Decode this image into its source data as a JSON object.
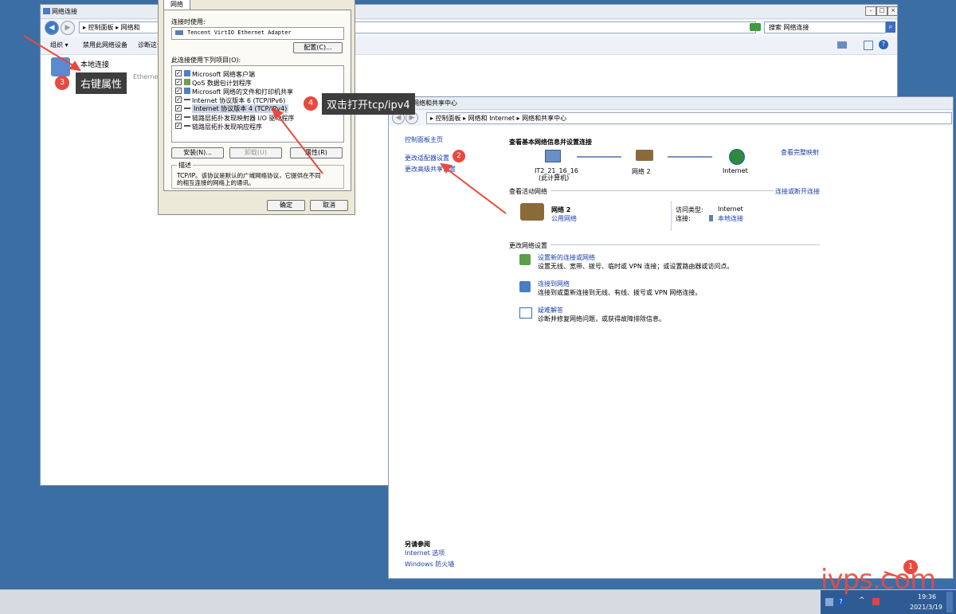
{
  "left_window": {
    "title": "网络连接",
    "address": "▸ 控制面板 ▸ 网络和",
    "search_placeholder": "搜索 网络连接",
    "toolbar": [
      "组织 ▾",
      "禁用此网络设备",
      "诊断这个"
    ],
    "item_name": "本地连接",
    "item_sub": "Ethernet A"
  },
  "dialog": {
    "tab": "网络",
    "connect_using_label": "连接时使用:",
    "adapter": "Tencent VirtIO Ethernet Adapter",
    "configure_button": "配置(C)...",
    "items_label": "此连接使用下列项目(O):",
    "items": [
      {
        "text": "Microsoft 网络客户端",
        "checked": true
      },
      {
        "text": "QoS 数据包计划程序",
        "checked": true
      },
      {
        "text": "Microsoft 网络的文件和打印机共享",
        "checked": true
      },
      {
        "text": "Internet 协议版本 6 (TCP/IPv6)",
        "checked": true
      },
      {
        "text": "Internet 协议版本 4 (TCP/IPv4)",
        "checked": true,
        "selected": true
      },
      {
        "text": "链路层拓扑发现映射器 I/O 驱动程序",
        "checked": true
      },
      {
        "text": "链路层拓扑发现响应程序",
        "checked": true
      }
    ],
    "install_button": "安装(N)...",
    "uninstall_button": "卸载(U)",
    "properties_button": "属性(R)",
    "desc_label": "描述",
    "desc_text_1": "TCP/IP。该协议是默认的广域网络协议，它提供在不同",
    "desc_text_2": "的相互连接的网络上的通讯。",
    "ok_button": "确定",
    "cancel_button": "取消"
  },
  "right_window": {
    "title": "网络和共享中心",
    "address": "▸ 控制面板 ▸ 网络和 Internet ▸ 网络和共享中心",
    "sidebar": {
      "home": "控制面板主页",
      "change_adapter": "更改适配器设置",
      "change_sharing": "更改高级共享设置",
      "see_also": "另请参阅",
      "internet_options": "Internet 选项",
      "firewall": "Windows 防火墙"
    },
    "heading": "查看基本网络信息并设置连接",
    "view_full_map": "查看完整映射",
    "map": {
      "computer": "IT2_21_16_16",
      "computer_sub": "(此计算机)",
      "network": "网络  2",
      "internet": "Internet"
    },
    "active_networks_label": "查看活动网络",
    "connect_disconnect": "连接或断开连接",
    "network_name": "网络  2",
    "network_type": "公用网络",
    "access_type_label": "访问类型:",
    "access_type_value": "Internet",
    "connection_label": "连接:",
    "connection_value": "本地连接",
    "change_settings_label": "更改网络设置",
    "tasks": [
      {
        "title": "设置新的连接或网络",
        "desc": "设置无线、宽带、拨号、临时或 VPN 连接；或设置路由器或访问点。"
      },
      {
        "title": "连接到网络",
        "desc": "连接到或重新连接到无线、有线、拨号或 VPN 网络连接。"
      },
      {
        "title": "疑难解答",
        "desc": "诊断并修复网络问题，或获得故障排除信息。"
      }
    ]
  },
  "annotations": {
    "badge1": "1",
    "badge2": "2",
    "badge3": "3",
    "badge4": "4",
    "callout3": "右键属性",
    "callout4": "双击打开tcp/ipv4"
  },
  "taskbar": {
    "time": "19:36",
    "date": "2021/3/19",
    "watermark": "ivps.com"
  },
  "colors": {
    "desktop": "#3a6ea5",
    "link": "#1a3ea8",
    "annotation_red": "#e84a3f"
  }
}
